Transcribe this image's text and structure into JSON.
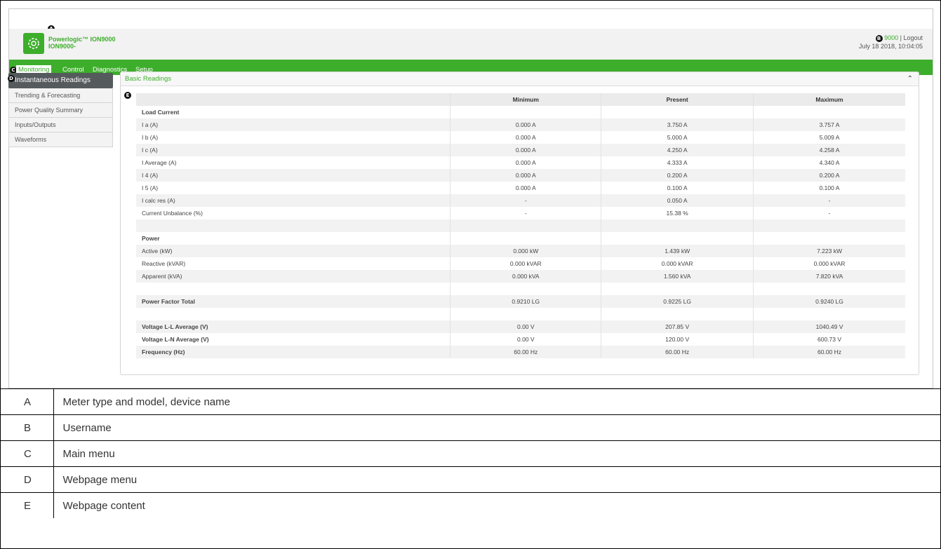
{
  "header": {
    "product_line1": "Powerlogic™ ION9000",
    "product_line2": "ION9000-",
    "username": "9000",
    "separator": "|",
    "logout_label": "Logout",
    "datetime": "July 18 2018, 10:04:05"
  },
  "markers": {
    "a": "A",
    "b": "B",
    "c": "C",
    "d": "D",
    "e": "E"
  },
  "main_menu": [
    {
      "label": "Monitoring",
      "active": true
    },
    {
      "label": "Control"
    },
    {
      "label": "Diagnostics"
    },
    {
      "label": "Setup"
    }
  ],
  "page_menu": [
    {
      "label": "Instantaneous Readings",
      "active": true
    },
    {
      "label": "Trending & Forecasting"
    },
    {
      "label": "Power Quality Summary"
    },
    {
      "label": "Inputs/Outputs"
    },
    {
      "label": "Waveforms"
    }
  ],
  "panel": {
    "title": "Basic Readings",
    "collapse_icon": "chevron-up-icon"
  },
  "table": {
    "headers": [
      "",
      "Minimum",
      "Present",
      "Maximum"
    ],
    "rows": [
      [
        "Load Current",
        "",
        "",
        ""
      ],
      [
        "I a (A)",
        "0.000 A",
        "3.750 A",
        "3.757 A"
      ],
      [
        "I b (A)",
        "0.000 A",
        "5.000 A",
        "5.009 A"
      ],
      [
        "I c (A)",
        "0.000 A",
        "4.250 A",
        "4.258 A"
      ],
      [
        "I Average (A)",
        "0.000 A",
        "4.333 A",
        "4.340 A"
      ],
      [
        "I 4 (A)",
        "0.000 A",
        "0.200 A",
        "0.200 A"
      ],
      [
        "I 5 (A)",
        "0.000 A",
        "0.100 A",
        "0.100 A"
      ],
      [
        "I calc res (A)",
        "-",
        "0.050 A",
        "-"
      ],
      [
        "Current Unbalance (%)",
        "-",
        "15.38 %",
        "-"
      ],
      [
        "",
        "",
        "",
        ""
      ],
      [
        "Power",
        "",
        "",
        ""
      ],
      [
        "Active (kW)",
        "0.000 kW",
        "1.439 kW",
        "7.223 kW"
      ],
      [
        "Reactive (kVAR)",
        "0.000 kVAR",
        "0.000 kVAR",
        "0.000 kVAR"
      ],
      [
        "Apparent (kVA)",
        "0.000 kVA",
        "1.560 kVA",
        "7.820 kVA"
      ],
      [
        "",
        "",
        "",
        ""
      ],
      [
        "Power Factor Total",
        "0.9210 LG",
        "0.9225 LG",
        "0.9240 LG"
      ],
      [
        "",
        "",
        "",
        ""
      ],
      [
        "Voltage L-L Average (V)",
        "0.00 V",
        "207.85 V",
        "1040.49 V"
      ],
      [
        "Voltage L-N Average (V)",
        "0.00 V",
        "120.00 V",
        "600.73 V"
      ],
      [
        "Frequency (Hz)",
        "60.00 Hz",
        "60.00 Hz",
        "60.00 Hz"
      ]
    ],
    "bold_rows": [
      0,
      10,
      15,
      17,
      18,
      19
    ]
  },
  "legend": [
    {
      "key": "A",
      "description": "Meter type and model, device name"
    },
    {
      "key": "B",
      "description": "Username"
    },
    {
      "key": "C",
      "description": "Main menu"
    },
    {
      "key": "D",
      "description": "Webpage menu"
    },
    {
      "key": "E",
      "description": "Webpage content"
    }
  ],
  "colors": {
    "brand_green": "#3dae2b",
    "active_menu_bg": "#555a5d"
  }
}
